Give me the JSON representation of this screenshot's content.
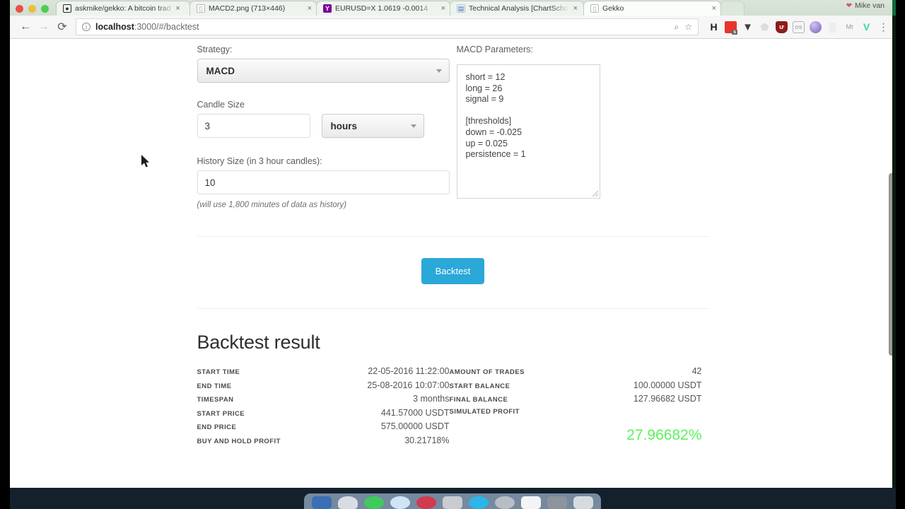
{
  "browser": {
    "tabs": [
      {
        "title": "askmike/gekko: A bitcoin trad",
        "favicon": "github-icon",
        "active": false,
        "close": "×"
      },
      {
        "title": "MACD2.png (713×446)",
        "favicon": "file-icon",
        "active": false,
        "close": "×"
      },
      {
        "title": "EURUSD=X 1.0619 -0.0014",
        "favicon": "yahoo-icon",
        "active": false,
        "close": "×"
      },
      {
        "title": "Technical Analysis [ChartScho",
        "favicon": "chart-icon",
        "active": false,
        "close": "×"
      },
      {
        "title": "Gekko",
        "favicon": "file-icon",
        "active": true,
        "close": "×"
      }
    ],
    "profile_name": "Mike van",
    "nav": {
      "back": "←",
      "forward": "→",
      "reload": "⟳"
    },
    "omnibox": {
      "info_icon": "i",
      "url_host": "localhost",
      "url_rest": ":3000/#/backtest",
      "zoom_icon": "⌕",
      "bookmark_icon": "☆"
    },
    "extensions": [
      {
        "name": "hypothesis-icon",
        "glyph": "H",
        "cls": "ext-h"
      },
      {
        "name": "screenshot-icon",
        "glyph": "",
        "cls": "ext-s"
      },
      {
        "name": "pocket-icon",
        "glyph": "▼",
        "cls": "ext-pocket"
      },
      {
        "name": "ghostery-icon",
        "glyph": "⬟",
        "cls": "ext-ghost"
      },
      {
        "name": "ublock-icon",
        "glyph": "ư",
        "cls": "ext-ub"
      },
      {
        "name": "lastfm-icon",
        "glyph": "os",
        "cls": "ext-os"
      },
      {
        "name": "orb-icon",
        "glyph": "",
        "cls": "ext-orb"
      },
      {
        "name": "qrcode-icon",
        "glyph": "▒",
        "cls": "ext-qr"
      },
      {
        "name": "metamask-icon",
        "glyph": "Mt",
        "cls": "ext-mt"
      },
      {
        "name": "vue-devtools-icon",
        "glyph": "V",
        "cls": "ext-v"
      },
      {
        "name": "chrome-menu-icon",
        "glyph": "⋮",
        "cls": "ext-menu"
      }
    ]
  },
  "form": {
    "strategy_label": "Strategy:",
    "strategy_value": "MACD",
    "candle_size_label": "Candle Size",
    "candle_size_value": "3",
    "candle_unit_value": "hours",
    "history_label": "History Size (in 3 hour candles):",
    "history_value": "10",
    "history_hint": "(will use 1,800 minutes of data as history)",
    "params_label": "MACD Parameters:",
    "params_value": "short = 12\nlong = 26\nsignal = 9\n\n[thresholds]\ndown = -0.025\nup = 0.025\npersistence = 1",
    "backtest_button": "Backtest"
  },
  "results": {
    "title": "Backtest result",
    "left": [
      {
        "key": "START TIME",
        "value": "22-05-2016 11:22:00"
      },
      {
        "key": "END TIME",
        "value": "25-08-2016 10:07:00"
      },
      {
        "key": "TIMESPAN",
        "value": "3 months"
      },
      {
        "key": "START PRICE",
        "value": "441.57000 USDT"
      },
      {
        "key": "END PRICE",
        "value": "575.00000 USDT"
      },
      {
        "key": "BUY AND HOLD PROFIT",
        "value": "30.21718%"
      }
    ],
    "right": [
      {
        "key": "AMOUNT OF TRADES",
        "value": "42"
      },
      {
        "key": "START BALANCE",
        "value": "100.00000 USDT"
      },
      {
        "key": "FINAL BALANCE",
        "value": "127.96682 USDT"
      },
      {
        "key": "SIMULATED PROFIT",
        "value": ""
      }
    ],
    "profit": "27.96682%",
    "profit_color": "#5cf25c"
  }
}
